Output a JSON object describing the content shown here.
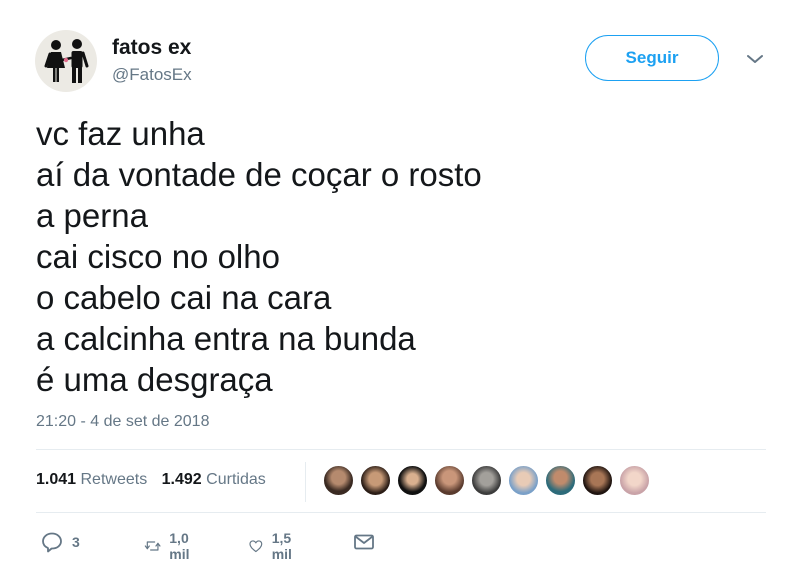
{
  "author": {
    "name": "fatos ex",
    "handle": "@FatosEx",
    "avatar_icon": "couple-figures-icon"
  },
  "follow_button": {
    "label": "Seguir"
  },
  "menu_icon": "chevron-down-icon",
  "tweet": {
    "lines": [
      "vc faz unha",
      "aí da vontade de coçar o rosto",
      "a perna",
      "cai cisco no olho",
      "o cabelo cai na cara",
      "a calcinha entra na bunda",
      "é uma desgraça"
    ],
    "timestamp": "21:20 - 4 de set de 2018"
  },
  "stats": {
    "retweets_count": "1.041",
    "retweets_label": "Retweets",
    "likes_count": "1.492",
    "likes_label": "Curtidas"
  },
  "likers_count_shown": 9,
  "actions": {
    "reply_count": "3",
    "retweet_count": "1,0 mil",
    "like_count": "1,5 mil"
  },
  "colors": {
    "accent": "#1da1f2",
    "secondary_text": "#657786",
    "divider": "#e6ecf0"
  }
}
